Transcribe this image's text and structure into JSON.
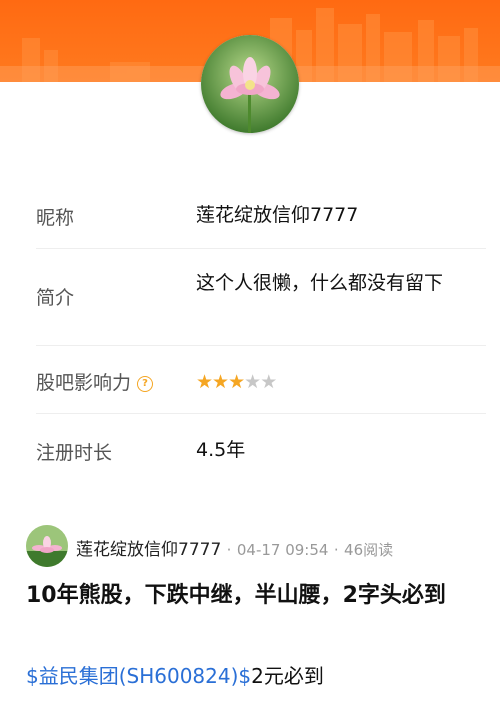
{
  "profile": {
    "nickname_label": "昵称",
    "nickname_value": "莲花绽放信仰7777",
    "bio_label": "简介",
    "bio_value": "这个人很懒，什么都没有留下",
    "influence_label": "股吧影响力",
    "influence_help": "?",
    "influence_stars": 3,
    "influence_stars_max": 5,
    "register_label": "注册时长",
    "register_value": "4.5年"
  },
  "post": {
    "author": "莲花绽放信仰7777",
    "sep": "·",
    "time": "04-17 09:54",
    "reads": "46阅读",
    "title": "10年熊股，下跌中继，半山腰，2字头必到",
    "stock_link": "$益民集团(SH600824)$",
    "body_rest": "2元必到"
  },
  "colors": {
    "banner": "#ff6a12",
    "link": "#2a6fd6",
    "star": "#f5a623"
  }
}
